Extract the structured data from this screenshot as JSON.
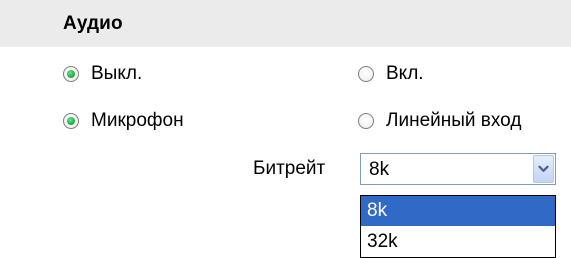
{
  "audio": {
    "title": "Аудио",
    "audio_state": {
      "options": [
        {
          "label": "Выкл.",
          "checked": true
        },
        {
          "label": "Вкл.",
          "checked": false
        }
      ]
    },
    "input_source": {
      "options": [
        {
          "label": "Микрофон",
          "checked": true
        },
        {
          "label": "Линейный вход",
          "checked": false
        }
      ]
    },
    "bitrate": {
      "label": "Битрейт",
      "selected": "8k",
      "options": [
        "8k",
        "32k"
      ],
      "highlighted_option": "8k"
    }
  },
  "colors": {
    "header_bg": "#ebebeb",
    "radio_checked": "#16a83b",
    "select_border": "#7f9db9",
    "highlight_bg": "#3169c6"
  },
  "icons": {
    "select_arrow": "chevron-down-icon"
  }
}
